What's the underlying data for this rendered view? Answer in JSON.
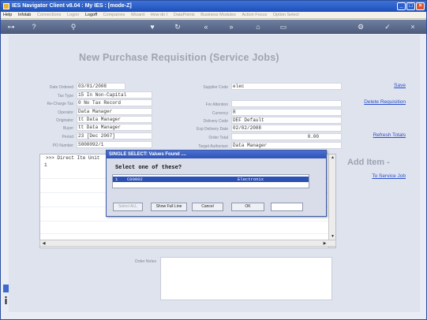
{
  "window": {
    "title": "IES Navigator Client v8.04 : My IES :      [mode-Z]",
    "controls": [
      "_",
      "□",
      "×"
    ]
  },
  "menu": {
    "items": [
      {
        "label": "Help",
        "enabled": true
      },
      {
        "label": "Infolab",
        "enabled": true
      },
      {
        "label": "Connections",
        "enabled": false
      },
      {
        "label": "Logon",
        "enabled": false
      },
      {
        "label": "Logoff",
        "enabled": true
      },
      {
        "label": "Companies",
        "enabled": false
      },
      {
        "label": "Wizard",
        "enabled": false
      },
      {
        "label": "How do I",
        "enabled": false
      },
      {
        "label": "DataPoints",
        "enabled": false
      },
      {
        "label": "Business Modules",
        "enabled": false
      },
      {
        "label": "Action Focus",
        "enabled": false
      },
      {
        "label": "Option Select",
        "enabled": false
      }
    ]
  },
  "toolbar": {
    "icons": [
      {
        "name": "back-key-icon",
        "glyph": "⊶"
      },
      {
        "name": "help-icon",
        "glyph": "?"
      },
      {
        "name": "search-icon",
        "glyph": "⚲"
      },
      {
        "name": "heart-icon",
        "glyph": "♥"
      },
      {
        "name": "refresh-icon",
        "glyph": "↻"
      },
      {
        "name": "rewind-icon",
        "glyph": "«"
      },
      {
        "name": "forward-icon",
        "glyph": "»"
      },
      {
        "name": "home-icon",
        "glyph": "⌂"
      },
      {
        "name": "page-icon",
        "glyph": "▭"
      },
      {
        "name": "gear-icon",
        "glyph": "⚙"
      },
      {
        "name": "check-icon",
        "glyph": "✓"
      },
      {
        "name": "close-icon",
        "glyph": "×"
      }
    ]
  },
  "page": {
    "title": "New Purchase Requisition (Service Jobs)"
  },
  "left_fields": [
    {
      "label": "Date Ordered",
      "value": "03/01/2008"
    },
    {
      "label": "Tax Type",
      "value": "15 In Non-Capital"
    },
    {
      "label": "Re-Charge Tax",
      "value": "0 No Tax Record"
    },
    {
      "label": "Operator",
      "value": "Data Manager"
    },
    {
      "label": "Originator",
      "value": "tt Data Manager"
    },
    {
      "label": "Buyer",
      "value": "tt Data Manager"
    },
    {
      "label": "Period",
      "value": "23  [Dec 2007]"
    },
    {
      "label": "PO Number",
      "value": "S000092/1"
    }
  ],
  "right_fields": [
    {
      "label": "Supplier Code",
      "value": "elec"
    },
    {
      "label": "For Attention",
      "value": ""
    },
    {
      "label": "Currency",
      "value": "R"
    },
    {
      "label": "Delivery Code",
      "value": "DEF Default"
    },
    {
      "label": "Exp Delivery Date",
      "value": "02/02/2008"
    },
    {
      "label": "Order Total",
      "value": "0.00"
    },
    {
      "label": "Target Authoriser",
      "value": "Data Manager"
    }
  ],
  "actions": {
    "save": "Save",
    "delete": "Delete Requisition",
    "refresh": "Refresh Totals",
    "add_item": "Add Item -",
    "to_service_job": "To Service Job"
  },
  "grid": {
    "header": ">>> Direct Ite Unit",
    "first_row_num": "1"
  },
  "notes": {
    "label": "Order Notes"
  },
  "dialog": {
    "title": "SINGLE SELECT: Values Found ....",
    "prompt": "Select one of these?",
    "selected_row": {
      "index": "1",
      "code": "C00002",
      "name": "Electronix"
    },
    "buttons": {
      "select_all": "Select ALL",
      "show_full_line": "Show Full Line",
      "cancel": "Cancel",
      "ok": "OK"
    }
  }
}
